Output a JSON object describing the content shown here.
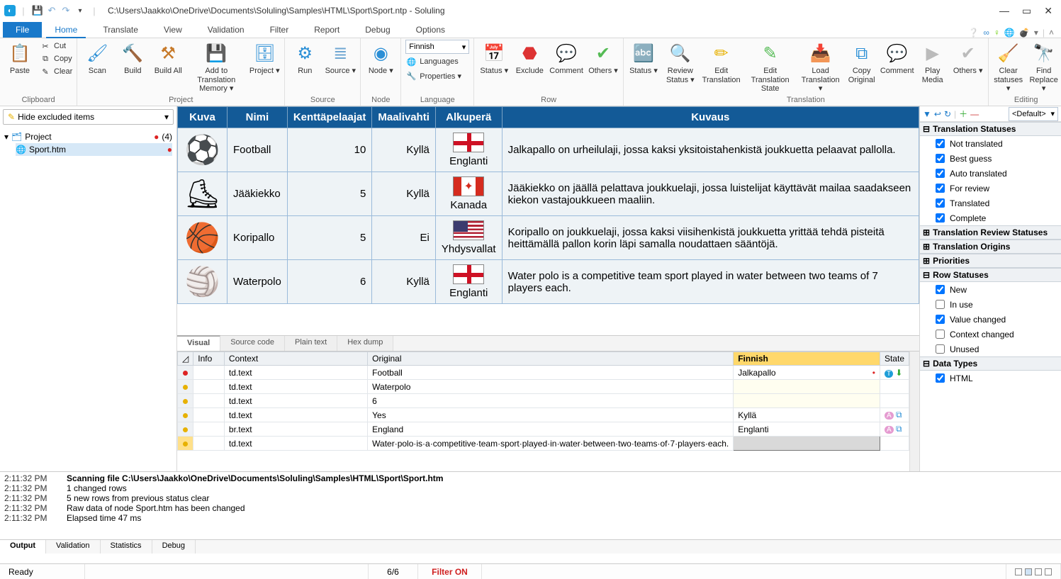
{
  "title": "C:\\Users\\Jaakko\\OneDrive\\Documents\\Soluling\\Samples\\HTML\\Sport\\Sport.ntp  -  Soluling",
  "menu": {
    "file": "File",
    "home": "Home",
    "translate": "Translate",
    "view": "View",
    "validation": "Validation",
    "filter": "Filter",
    "report": "Report",
    "debug": "Debug",
    "options": "Options"
  },
  "ribbon": {
    "clipboard": {
      "label": "Clipboard",
      "paste": "Paste",
      "cut": "Cut",
      "copy": "Copy",
      "clear": "Clear"
    },
    "project": {
      "label": "Project",
      "scan": "Scan",
      "build": "Build",
      "buildall": "Build All",
      "addtm": "Add to Translation Memory ▾",
      "projectbtn": "Project ▾"
    },
    "source": {
      "label": "Source",
      "run": "Run",
      "sourcebtn": "Source ▾"
    },
    "node": {
      "label": "Node",
      "nodebtn": "Node ▾"
    },
    "language": {
      "label": "Language",
      "combo": "Finnish",
      "languages": "Languages",
      "properties": "Properties ▾"
    },
    "row": {
      "label": "Row",
      "status": "Status ▾",
      "exclude": "Exclude",
      "comment": "Comment",
      "others": "Others ▾"
    },
    "translation": {
      "label": "Translation",
      "status2": "Status ▾",
      "review": "Review Status ▾",
      "edit": "Edit Translation",
      "editstate": "Edit Translation State",
      "load": "Load Translation ▾",
      "copyorig": "Copy Original",
      "comment2": "Comment",
      "playmedia": "Play Media",
      "others2": "Others ▾"
    },
    "editing": {
      "label": "Editing",
      "clear": "Clear statuses ▾",
      "find": "Find Replace ▾"
    }
  },
  "left": {
    "filter": "Hide excluded items",
    "project": "Project",
    "count": "(4)",
    "file": "Sport.htm"
  },
  "sport": {
    "headers": {
      "kuva": "Kuva",
      "nimi": "Nimi",
      "kentta": "Kenttäpelaajat",
      "maali": "Maalivahti",
      "alku": "Alkuperä",
      "kuvaus": "Kuvaus"
    },
    "rows": [
      {
        "name": "Football",
        "players": "10",
        "goalie": "Kyllä",
        "origin": "Englanti",
        "flag": "en",
        "desc": "Jalkapallo on urheilulaji, jossa kaksi yksitoistahenkistä joukkuetta pelaavat pallolla."
      },
      {
        "name": "Jääkiekko",
        "players": "5",
        "goalie": "Kyllä",
        "origin": "Kanada",
        "flag": "ca",
        "desc": "Jääkiekko on jäällä pelattava joukkuelaji, jossa luistelijat käyttävät mailaa saadakseen kiekon vastajoukkueen maaliin."
      },
      {
        "name": "Koripallo",
        "players": "5",
        "goalie": "Ei",
        "origin": "Yhdysvallat",
        "flag": "us",
        "desc": "Koripallo on joukkuelaji, jossa kaksi viisihenkistä joukkuetta yrittää tehdä pisteitä heittämällä pallon korin läpi samalla noudattaen sääntöjä."
      },
      {
        "name": "Waterpolo",
        "players": "6",
        "goalie": "Kyllä",
        "origin": "Englanti",
        "flag": "en",
        "desc": "Water polo is a competitive team sport played in water between two teams of 7 players each."
      }
    ]
  },
  "viewtabs": {
    "visual": "Visual",
    "source": "Source code",
    "plain": "Plain text",
    "hex": "Hex dump"
  },
  "grid": {
    "headers": {
      "info": "Info",
      "context": "Context",
      "original": "Original",
      "finnish": "Finnish",
      "state": "State"
    },
    "rows": [
      {
        "mark": "red",
        "context": "td.text",
        "original": "Football",
        "finnish": "Jalkapallo",
        "state": "TS"
      },
      {
        "mark": "yel",
        "context": "td.text",
        "original": "Waterpolo",
        "finnish": "",
        "state": ""
      },
      {
        "mark": "yel",
        "context": "td.text",
        "original": "6",
        "finnish": "",
        "state": ""
      },
      {
        "mark": "yel",
        "context": "td.text",
        "original": "Yes",
        "finnish": "Kyllä",
        "state": "A"
      },
      {
        "mark": "yel",
        "context": "br.text",
        "original": "England",
        "finnish": "Englanti",
        "state": "A"
      },
      {
        "mark": "yel",
        "context": "td.text",
        "original": "Water·polo·is·a·competitive·team·sport·played·in·water·between·two·teams·of·7·players·each.",
        "finnish": "",
        "state": "",
        "sel": true
      }
    ]
  },
  "right": {
    "default": "<Default>",
    "s1": "Translation Statuses",
    "s1items": [
      "Not translated",
      "Best guess",
      "Auto translated",
      "For review",
      "Translated",
      "Complete"
    ],
    "s2": "Translation Review Statuses",
    "s3": "Translation Origins",
    "s4": "Priorities",
    "s5": "Row Statuses",
    "s5items": [
      [
        "New",
        true
      ],
      [
        "In use",
        false
      ],
      [
        "Value changed",
        true
      ],
      [
        "Context changed",
        false
      ],
      [
        "Unused",
        false
      ]
    ],
    "s6": "Data Types",
    "s6items": [
      "HTML"
    ]
  },
  "log": [
    [
      "2:11:32 PM",
      "Scanning file C:\\Users\\Jaakko\\OneDrive\\Documents\\Soluling\\Samples\\HTML\\Sport\\Sport.htm"
    ],
    [
      "2:11:32 PM",
      "1 changed rows"
    ],
    [
      "2:11:32 PM",
      "5 new rows from previous status clear"
    ],
    [
      "2:11:32 PM",
      "Raw data of node Sport.htm has been changed"
    ],
    [
      "2:11:32 PM",
      "Elapsed time 47 ms"
    ]
  ],
  "bottomtabs": {
    "output": "Output",
    "validation": "Validation",
    "statistics": "Statistics",
    "debug": "Debug"
  },
  "status": {
    "ready": "Ready",
    "count": "6/6",
    "filter": "Filter ON"
  }
}
